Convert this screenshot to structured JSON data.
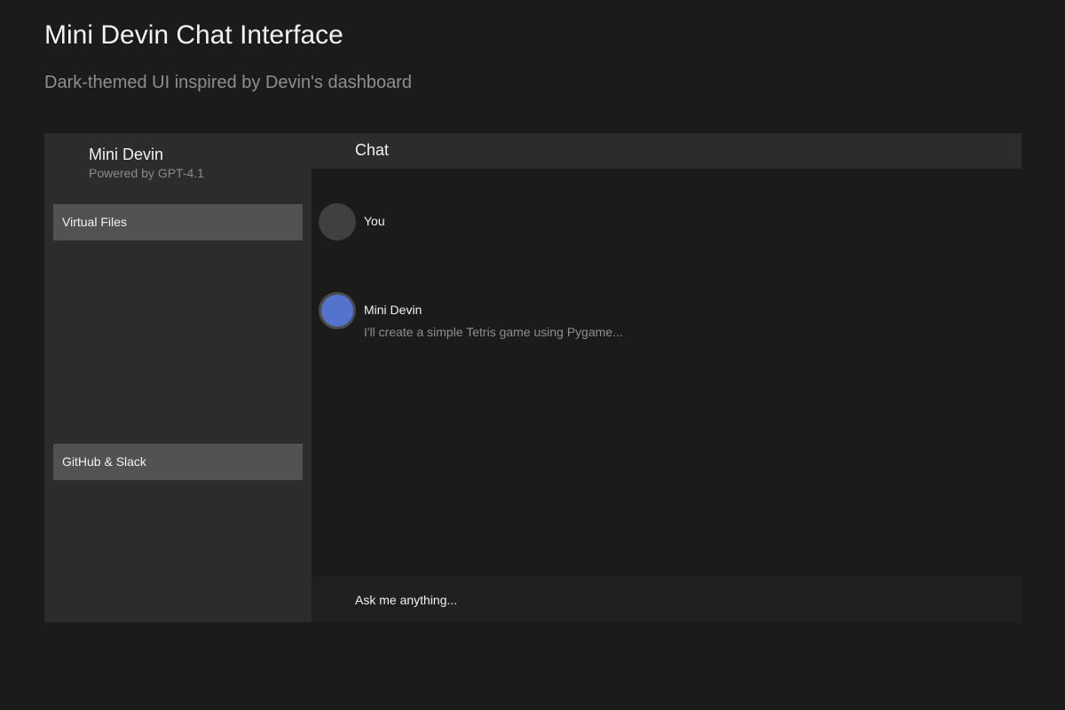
{
  "page": {
    "title": "Mini Devin Chat Interface",
    "subtitle": "Dark-themed UI inspired by Devin's dashboard"
  },
  "sidebar": {
    "brand_name": "Mini Devin",
    "brand_sub": "Powered by GPT-4.1",
    "buttons": [
      {
        "label": "Virtual Files"
      },
      {
        "label": "GitHub & Slack"
      }
    ]
  },
  "chat": {
    "title": "Chat",
    "messages": [
      {
        "author": "You",
        "text": "",
        "avatar_color": "#404040"
      },
      {
        "author": "Mini Devin",
        "text": "I'll create a simple Tetris game using Pygame...",
        "avatar_color": "#5473cc"
      }
    ],
    "input_placeholder": "Ask me anything..."
  },
  "colors": {
    "background": "#1b1b1b",
    "panel": "#2c2c2c",
    "button": "#525252",
    "accent": "#5473cc"
  }
}
